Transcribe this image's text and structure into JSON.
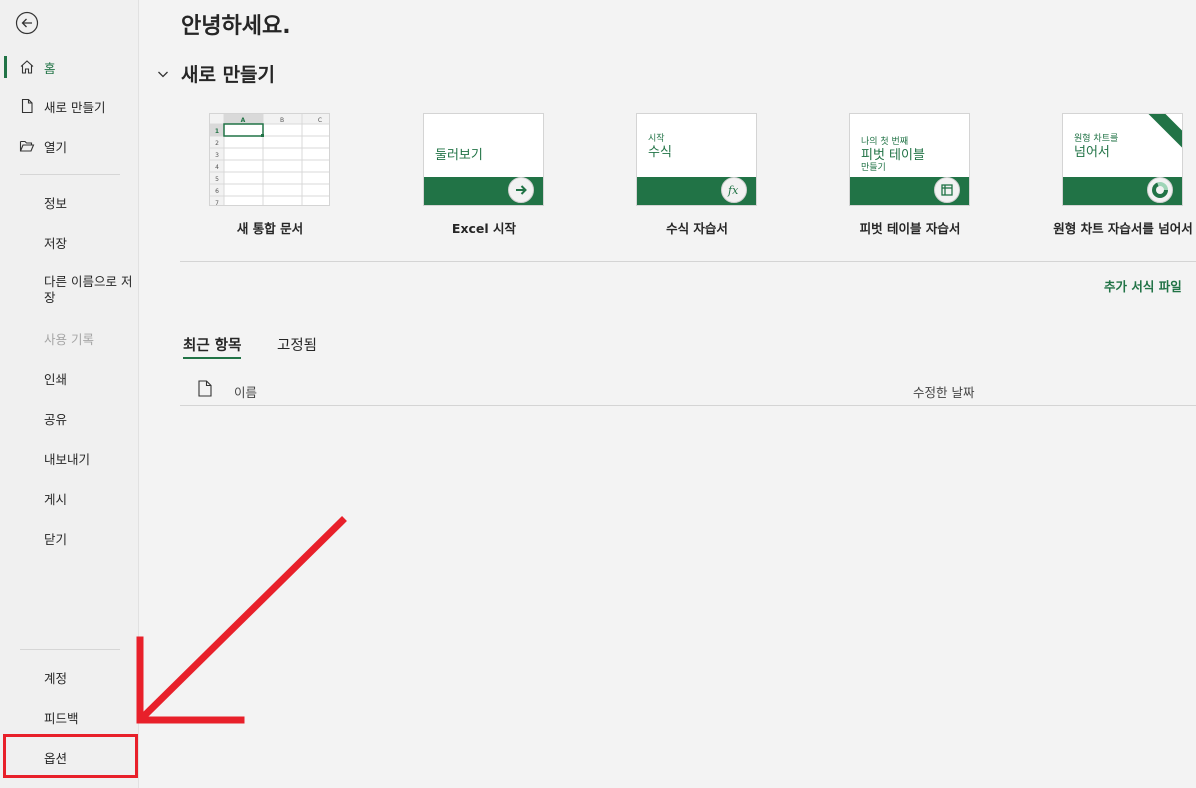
{
  "sidebar": {
    "back_icon": "back-arrow-icon",
    "items": [
      {
        "label": "홈",
        "icon": "home-icon"
      },
      {
        "label": "새로 만들기",
        "icon": "new-document-icon"
      },
      {
        "label": "열기",
        "icon": "folder-open-icon"
      },
      {
        "label": "정보"
      },
      {
        "label": "저장"
      },
      {
        "label": "다른 이름으로 저장"
      },
      {
        "label": "사용 기록"
      },
      {
        "label": "인쇄"
      },
      {
        "label": "공유"
      },
      {
        "label": "내보내기"
      },
      {
        "label": "게시"
      },
      {
        "label": "닫기"
      }
    ],
    "bottom_items": [
      {
        "label": "계정"
      },
      {
        "label": "피드백"
      },
      {
        "label": "옵션"
      }
    ]
  },
  "main": {
    "greeting": "안녕하세요.",
    "new_section_title": "새로 만들기",
    "templates": [
      {
        "caption": "새 통합 문서"
      },
      {
        "caption": "Excel 시작",
        "thumb_text": "둘러보기"
      },
      {
        "caption": "수식 자습서",
        "thumb_small": "시작",
        "thumb_big": "수식"
      },
      {
        "caption": "피벗 테이블 자습서",
        "thumb_small": "나의 첫 번째",
        "thumb_big": "피벗 테이블",
        "thumb_small2": "만들기"
      },
      {
        "caption": "원형 차트 자습서를 넘어서",
        "thumb_small": "원형 차트를",
        "thumb_big": "넘어서"
      }
    ],
    "grid_thumb": {
      "columns": [
        "A",
        "B",
        "C"
      ],
      "rows": [
        "1",
        "2",
        "3",
        "4",
        "5",
        "6",
        "7"
      ]
    },
    "more_templates": "추가 서식 파일",
    "tabs": [
      {
        "label": "최근 항목"
      },
      {
        "label": "고정됨"
      }
    ],
    "list_header": {
      "name": "이름",
      "modified": "수정한 날짜"
    }
  },
  "colors": {
    "accent": "#217346",
    "annotation": "#e8202a"
  }
}
